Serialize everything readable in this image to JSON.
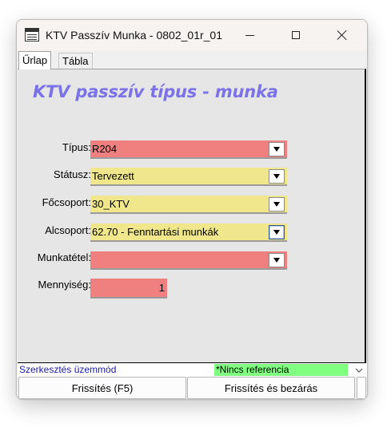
{
  "window": {
    "title": "KTV Passzív Munka - 0802_01r_01",
    "icons": [
      "form-icon",
      "minimize-icon",
      "maximize-icon",
      "close-icon"
    ]
  },
  "tabs": [
    {
      "label": "Űrlap",
      "active": true
    },
    {
      "label": "Tábla",
      "active": false
    }
  ],
  "form": {
    "heading": "KTV passzív típus - munka",
    "fields": [
      {
        "label": "Típus:",
        "value": "R204",
        "type": "dropdown",
        "color": "#f08080"
      },
      {
        "label": "Státusz:",
        "value": "Tervezett",
        "type": "dropdown",
        "color": "#f0e68c"
      },
      {
        "label": "Főcsoport:",
        "value": "30_KTV",
        "type": "dropdown",
        "color": "#f0e68c"
      },
      {
        "label": "Alcsoport:",
        "value": "62.70 - Fenntartási munkák",
        "type": "dropdown",
        "color": "#f0e68c"
      },
      {
        "label": "Munkatétel:",
        "value": "",
        "type": "dropdown",
        "color": "#f08080"
      },
      {
        "label": "Mennyiség:",
        "value": "1",
        "type": "number",
        "color": "#f08080"
      }
    ]
  },
  "status": {
    "mode": "Szerkesztés üzemmód",
    "reference": "*Nincs referencia",
    "reference_color": "#80ff80"
  },
  "buttons": {
    "refresh": "Frissítés (F5)",
    "refresh_close": "Frissítés és bezárás"
  }
}
